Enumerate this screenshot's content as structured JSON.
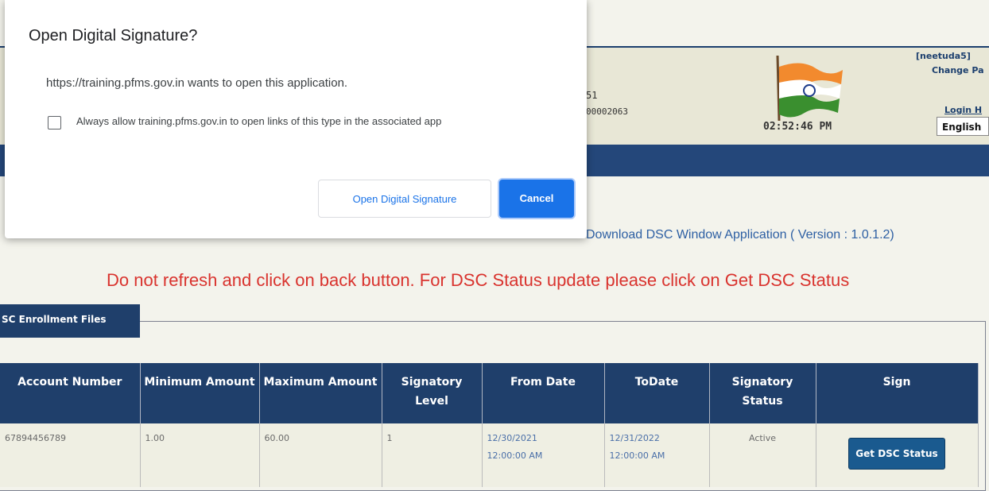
{
  "header": {
    "text_line1": "51",
    "text_line2": "00002063",
    "clock": "02:52:46 PM",
    "user_name": "[neetuda5]",
    "change_password": "Change Pa",
    "login_history": "Login H",
    "language": "English"
  },
  "download_link": "Download DSC Window Application ( Version : 1.0.1.2)",
  "warning": "Do not refresh and click on back button. For DSC Status update please click on Get DSC Status",
  "section_tab": "SC Enrollment Files",
  "table": {
    "headers": {
      "account_number": "Account Number",
      "min_amount": "Minimum Amount",
      "max_amount": "Maximum Amount",
      "signatory_level": "Signatory Level",
      "from_date": "From Date",
      "to_date": "ToDate",
      "signatory_status": "Signatory Status",
      "sign": "Sign"
    },
    "row": {
      "account_number": "67894456789",
      "min_amount": "1.00",
      "max_amount": "60.00",
      "signatory_level": "1",
      "from_date_line1": "12/30/2021",
      "from_date_line2": "12:00:00 AM",
      "to_date_line1": "12/31/2022",
      "to_date_line2": "12:00:00 AM",
      "signatory_status": "Active",
      "sign_button": "Get DSC Status"
    }
  },
  "dialog": {
    "title": "Open Digital Signature?",
    "message": "https://training.pfms.gov.in wants to open this application.",
    "checkbox_label": "Always allow training.pfms.gov.in to open links of this type in the associated app",
    "checkbox_checked": false,
    "open_button": "Open Digital Signature",
    "cancel_button": "Cancel"
  },
  "colors": {
    "nav_blue": "#24477a",
    "warning_red": "#d9332e",
    "link_blue": "#2d5fa3",
    "dialog_primary": "#1a73e8"
  }
}
